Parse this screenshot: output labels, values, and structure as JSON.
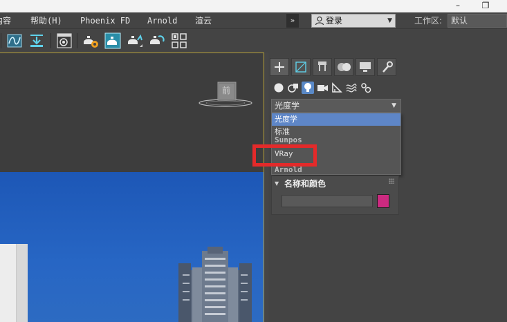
{
  "window": {
    "minimize_glyph": "–",
    "maximize_glyph": "❐"
  },
  "menu": {
    "items": [
      {
        "label": "内容",
        "name": "menu-content"
      },
      {
        "label": "帮助(H)",
        "name": "menu-help"
      },
      {
        "label": "Phoenix FD",
        "name": "menu-phoenix-fd"
      },
      {
        "label": "Arnold",
        "name": "menu-arnold"
      },
      {
        "label": "渲云",
        "name": "menu-xuanyun"
      }
    ],
    "overflow_glyph": "»",
    "login": {
      "label": "登录",
      "caret": "▼"
    },
    "workspace": {
      "label": "工作区:",
      "value": "默认"
    }
  },
  "toolbar": {
    "buttons": [
      "curve-editor-icon",
      "schematic-view-icon",
      "save-down-icon",
      "material-editor-icon",
      "render-setup-icon",
      "rendered-frame-icon",
      "render-production-icon",
      "render-iterative-icon",
      "render-region-icon"
    ]
  },
  "viewport": {
    "viewcube_label": "前"
  },
  "command_panel": {
    "tabs": [
      "create-tab",
      "modify-tab",
      "hierarchy-tab",
      "motion-tab",
      "display-tab",
      "utilities-tab"
    ],
    "subcategories": [
      "geometry",
      "shapes",
      "lights",
      "cameras",
      "helpers",
      "space-warps",
      "systems"
    ],
    "active_subcategory": "lights",
    "dropdown": {
      "value": "光度学",
      "caret": "▼"
    },
    "dropdown_options": [
      {
        "label": "光度学",
        "selected": true
      },
      {
        "label": "标准",
        "selected": false
      },
      {
        "label": "Sunpos",
        "selected": false,
        "partial": true
      },
      {
        "label": "VRay",
        "selected": false
      },
      {
        "label": "Arnold",
        "selected": false,
        "partial": true
      }
    ],
    "rollout": {
      "title": "名称和颜色",
      "arrow": "▼",
      "name_value": "",
      "color": "#cc2a80"
    }
  },
  "annotation": {
    "color": "#e42a2a"
  }
}
